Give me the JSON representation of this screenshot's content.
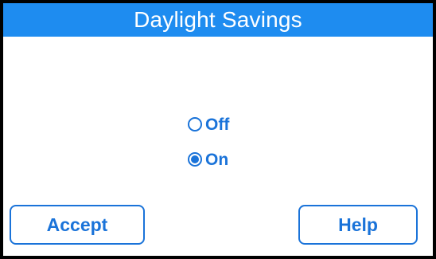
{
  "header": {
    "title": "Daylight Savings"
  },
  "options": [
    {
      "label": "Off",
      "selected": false
    },
    {
      "label": "On",
      "selected": true
    }
  ],
  "buttons": {
    "accept_label": "Accept",
    "help_label": "Help"
  },
  "colors": {
    "title_bar": "#1e8cf0",
    "accent": "#1a73d9",
    "background": "#ffffff",
    "frame": "#000000"
  },
  "icons": {
    "unselected": "radio-unchecked-icon",
    "selected": "radio-checked-icon"
  }
}
